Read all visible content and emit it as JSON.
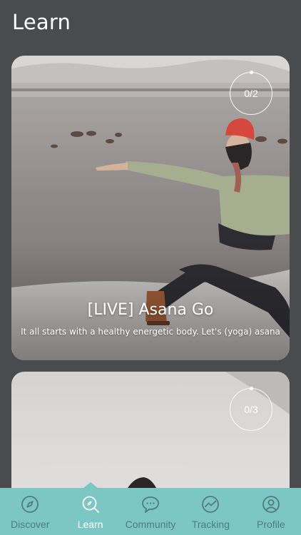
{
  "header": {
    "title": "Learn"
  },
  "courses": [
    {
      "progress": "0/2",
      "title": "[LIVE] Asana Go",
      "subtitle": "It all starts with a healthy energetic body. Let's (yoga) asana"
    },
    {
      "progress": "0/3",
      "title": "",
      "subtitle": ""
    }
  ],
  "tabbar": {
    "accent_color": "#7cc6c4",
    "tabs": [
      {
        "label": "Discover",
        "icon": "compass-icon",
        "active": false
      },
      {
        "label": "Learn",
        "icon": "search-icon",
        "active": true
      },
      {
        "label": "Community",
        "icon": "chat-bubble-icon",
        "active": false
      },
      {
        "label": "Tracking",
        "icon": "trend-chart-icon",
        "active": false
      },
      {
        "label": "Profile",
        "icon": "user-icon",
        "active": false
      }
    ]
  }
}
